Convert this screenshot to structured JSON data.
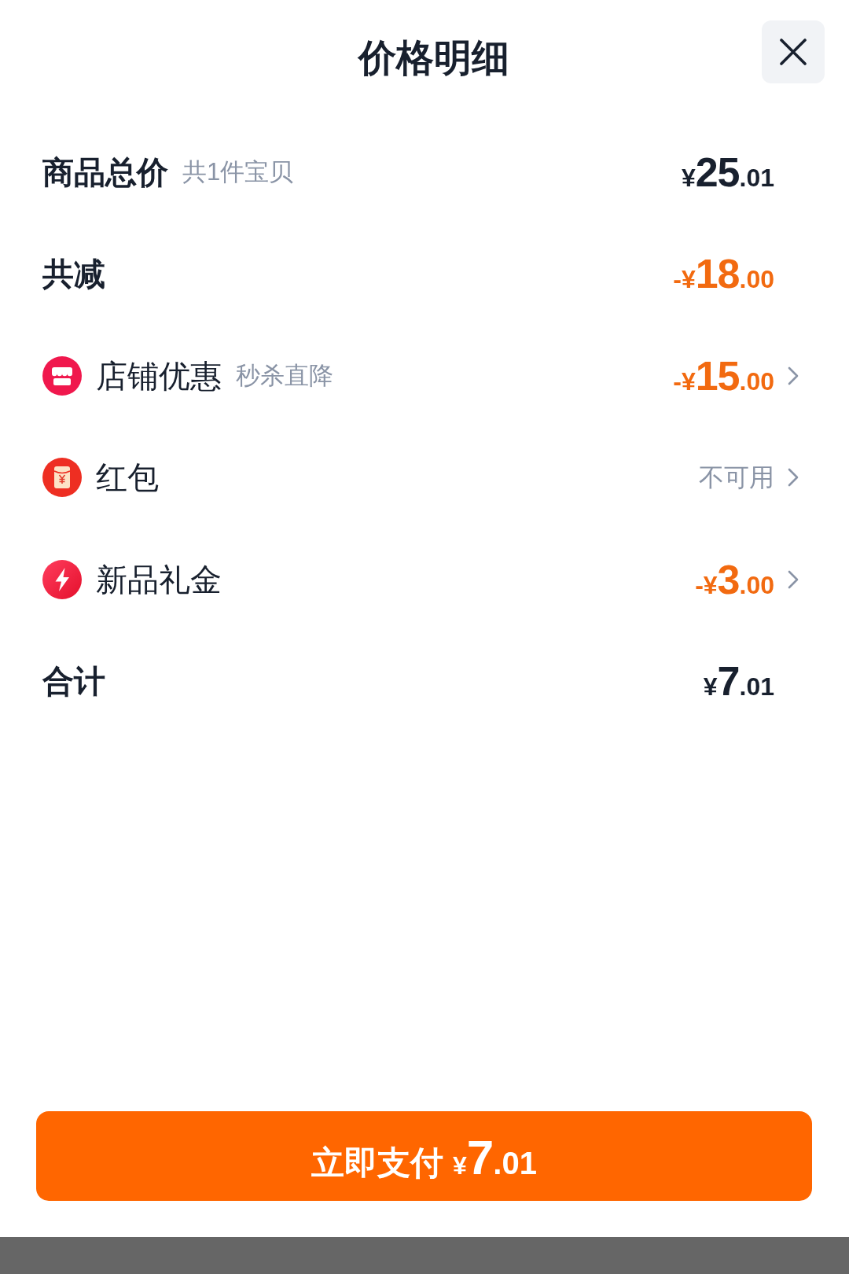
{
  "sheet": {
    "title": "价格明细"
  },
  "rows": [
    {
      "kind": "total",
      "label": "商品总价",
      "note": "共1件宝贝",
      "price": {
        "discount": false,
        "prefix": "¥",
        "whole": "25",
        "fraction": ".01"
      },
      "navigable": false
    },
    {
      "kind": "total",
      "label": "共减",
      "price": {
        "discount": true,
        "prefix": "-¥",
        "whole": "18",
        "fraction": ".00"
      },
      "navigable": false
    },
    {
      "kind": "store",
      "label": "店铺优惠",
      "note": "秒杀直降",
      "price": {
        "discount": true,
        "prefix": "-¥",
        "whole": "15",
        "fraction": ".00"
      },
      "navigable": true
    },
    {
      "kind": "packet",
      "label": "红包",
      "status": "不可用",
      "navigable": true
    },
    {
      "kind": "bolt",
      "label": "新品礼金",
      "price": {
        "discount": true,
        "prefix": "-¥",
        "whole": "3",
        "fraction": ".00"
      },
      "navigable": true
    },
    {
      "kind": "total",
      "label": "合计",
      "price": {
        "discount": false,
        "prefix": "¥",
        "whole": "7",
        "fraction": ".01"
      },
      "navigable": false
    }
  ],
  "pay_button": {
    "label": "立即支付",
    "price": {
      "prefix": "¥",
      "whole": "7",
      "fraction": ".01"
    }
  }
}
